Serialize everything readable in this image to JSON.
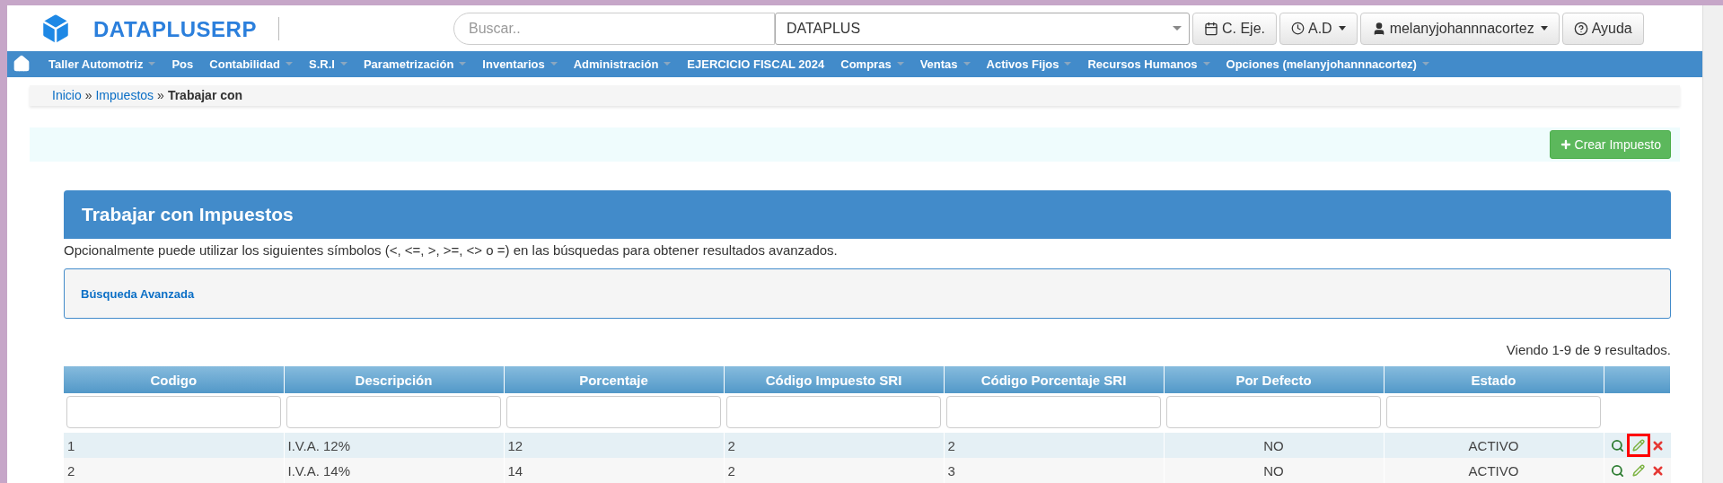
{
  "header": {
    "brand": "DATAPLUSERP",
    "search": {
      "placeholder": "Buscar.."
    },
    "company_select": {
      "value": "DATAPLUS"
    },
    "buttons": [
      {
        "label": "C. Eje.",
        "dropdown": false
      },
      {
        "label": "A.D",
        "dropdown": true
      },
      {
        "label": "melanyjohannnacortez",
        "dropdown": true
      },
      {
        "label": "Ayuda",
        "dropdown": false
      }
    ]
  },
  "menu": [
    {
      "label": "Taller Automotriz",
      "dropdown": true
    },
    {
      "label": "Pos",
      "dropdown": false
    },
    {
      "label": "Contabilidad",
      "dropdown": true
    },
    {
      "label": "S.R.I",
      "dropdown": true
    },
    {
      "label": "Parametrización",
      "dropdown": true
    },
    {
      "label": "Inventarios",
      "dropdown": true
    },
    {
      "label": "Administración",
      "dropdown": true
    },
    {
      "label": "EJERCICIO FISCAL 2024",
      "dropdown": false
    },
    {
      "label": "Compras",
      "dropdown": true
    },
    {
      "label": "Ventas",
      "dropdown": true
    },
    {
      "label": "Activos Fijos",
      "dropdown": true
    },
    {
      "label": "Recursos Humanos",
      "dropdown": true
    },
    {
      "label": "Opciones (melanyjohannnacortez)",
      "dropdown": true
    }
  ],
  "breadcrumb": {
    "separator": "»",
    "items": [
      {
        "label": "Inicio",
        "kind": "link"
      },
      {
        "label": "Impuestos",
        "kind": "link"
      },
      {
        "label": "Trabajar con",
        "kind": "current"
      }
    ]
  },
  "create_button": "Crear Impuesto",
  "panel": {
    "title": "Trabajar con Impuestos",
    "hint": "Opcionalmente puede utilizar los siguientes símbolos (<, <=, >, >=, <> o =) en las búsquedas para obtener resultados avanzados.",
    "advanced_search": "Búsqueda Avanzada"
  },
  "table": {
    "summary": "Viendo 1-9 de 9 resultados.",
    "columns": [
      "Codigo",
      "Descripción",
      "Porcentaje",
      "Código Impuesto SRI",
      "Código Porcentaje SRI",
      "Por Defecto",
      "Estado"
    ],
    "rows": [
      {
        "cells": [
          "1",
          "I.V.A. 12%",
          "12",
          "2",
          "2",
          "NO",
          "ACTIVO"
        ],
        "edit_highlighted": true
      },
      {
        "cells": [
          "2",
          "I.V.A. 14%",
          "14",
          "2",
          "3",
          "NO",
          "ACTIVO"
        ],
        "edit_highlighted": false
      }
    ]
  }
}
